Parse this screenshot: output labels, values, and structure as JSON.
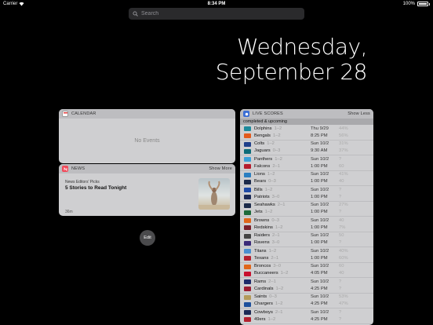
{
  "status_bar": {
    "carrier": "Carrier",
    "time": "8:34 PM",
    "battery": "100%"
  },
  "search": {
    "placeholder": "Search"
  },
  "date": {
    "weekday": "Wednesday,",
    "day": "September 28"
  },
  "calendar": {
    "title": "CALENDAR",
    "empty": "No Events"
  },
  "news": {
    "title": "NEWS",
    "action": "Show More",
    "source": "News Editors' Picks",
    "headline": "5 Stories to Read Tonight",
    "age": "36m"
  },
  "edit_label": "Edit",
  "scores": {
    "title": "LIVE SCORES",
    "action": "Show Less",
    "section": "completed & upcoming",
    "games": [
      {
        "t1": "Dolphins",
        "r1": "1–2",
        "t2": "Bengals",
        "r2": "1–2",
        "date": "Thu 9/29",
        "time": "8:25 PM",
        "p1": "44%",
        "p2": "56%",
        "c1": "#1e8a9c",
        "c2": "#e25a1c"
      },
      {
        "t1": "Colts",
        "r1": "1–2",
        "t2": "Jaguars",
        "r2": "0–3",
        "date": "Sun 10/2",
        "time": "9:30 AM",
        "p1": "31%",
        "p2": "37%",
        "c1": "#1f3f8a",
        "c2": "#0c6b78"
      },
      {
        "t1": "Panthers",
        "r1": "1–2",
        "t2": "Falcons",
        "r2": "2–1",
        "date": "Sun 10/2",
        "time": "1:00 PM",
        "p1": "?",
        "p2": "60",
        "c1": "#3aa0d8",
        "c2": "#b51c2c"
      },
      {
        "t1": "Lions",
        "r1": "1–2",
        "t2": "Bears",
        "r2": "0–3",
        "date": "Sun 10/2",
        "time": "1:00 PM",
        "p1": "41%",
        "p2": "40",
        "c1": "#2b7fc1",
        "c2": "#1b2a4a"
      },
      {
        "t1": "Bills",
        "r1": "1–2",
        "t2": "Patriots",
        "r2": "3–0",
        "date": "Sun 10/2",
        "time": "1:00 PM",
        "p1": "?",
        "p2": "?",
        "c1": "#1e4aa6",
        "c2": "#1c2a55"
      },
      {
        "t1": "Seahawks",
        "r1": "2–1",
        "t2": "Jets",
        "r2": "1–2",
        "date": "Sun 10/2",
        "time": "1:00 PM",
        "p1": "27%",
        "p2": "?",
        "c1": "#1b2a4a",
        "c2": "#1d6a3a"
      },
      {
        "t1": "Browns",
        "r1": "0–3",
        "t2": "Redskins",
        "r2": "1–2",
        "date": "Sun 10/2",
        "time": "1:00 PM",
        "p1": "40",
        "p2": "7%",
        "c1": "#e0661a",
        "c2": "#7a1f2b"
      },
      {
        "t1": "Raiders",
        "r1": "2–1",
        "t2": "Ravens",
        "r2": "3–0",
        "date": "Sun 10/2",
        "time": "1:00 PM",
        "p1": "50",
        "p2": "?",
        "c1": "#444",
        "c2": "#3b2a78"
      },
      {
        "t1": "Titans",
        "r1": "1–2",
        "t2": "Texans",
        "r2": "2–1",
        "date": "Sun 10/2",
        "time": "1:00 PM",
        "p1": "40%",
        "p2": "60%",
        "c1": "#4a8fd0",
        "c2": "#b3202e"
      },
      {
        "t1": "Broncos",
        "r1": "3–0",
        "t2": "Buccaneers",
        "r2": "1–2",
        "date": "Sun 10/2",
        "time": "4:05 PM",
        "p1": "60",
        "p2": "40",
        "c1": "#e0661a",
        "c2": "#c8102e"
      },
      {
        "t1": "Rams",
        "r1": "2–1",
        "t2": "Cardinals",
        "r2": "1–2",
        "date": "Sun 10/2",
        "time": "4:25 PM",
        "p1": "?",
        "p2": "?",
        "c1": "#1d2a6a",
        "c2": "#9b1b30"
      },
      {
        "t1": "Saints",
        "r1": "0–3",
        "t2": "Chargers",
        "r2": "1–2",
        "date": "Sun 10/2",
        "time": "4:25 PM",
        "p1": "53%",
        "p2": "47%",
        "c1": "#b39a5a",
        "c2": "#1c4f9c"
      },
      {
        "t1": "Cowboys",
        "r1": "2–1",
        "t2": "49ers",
        "r2": "1–2",
        "date": "Sun 10/2",
        "time": "4:25 PM",
        "p1": "?",
        "p2": "?",
        "c1": "#1c2a55",
        "c2": "#b3202e"
      }
    ]
  }
}
